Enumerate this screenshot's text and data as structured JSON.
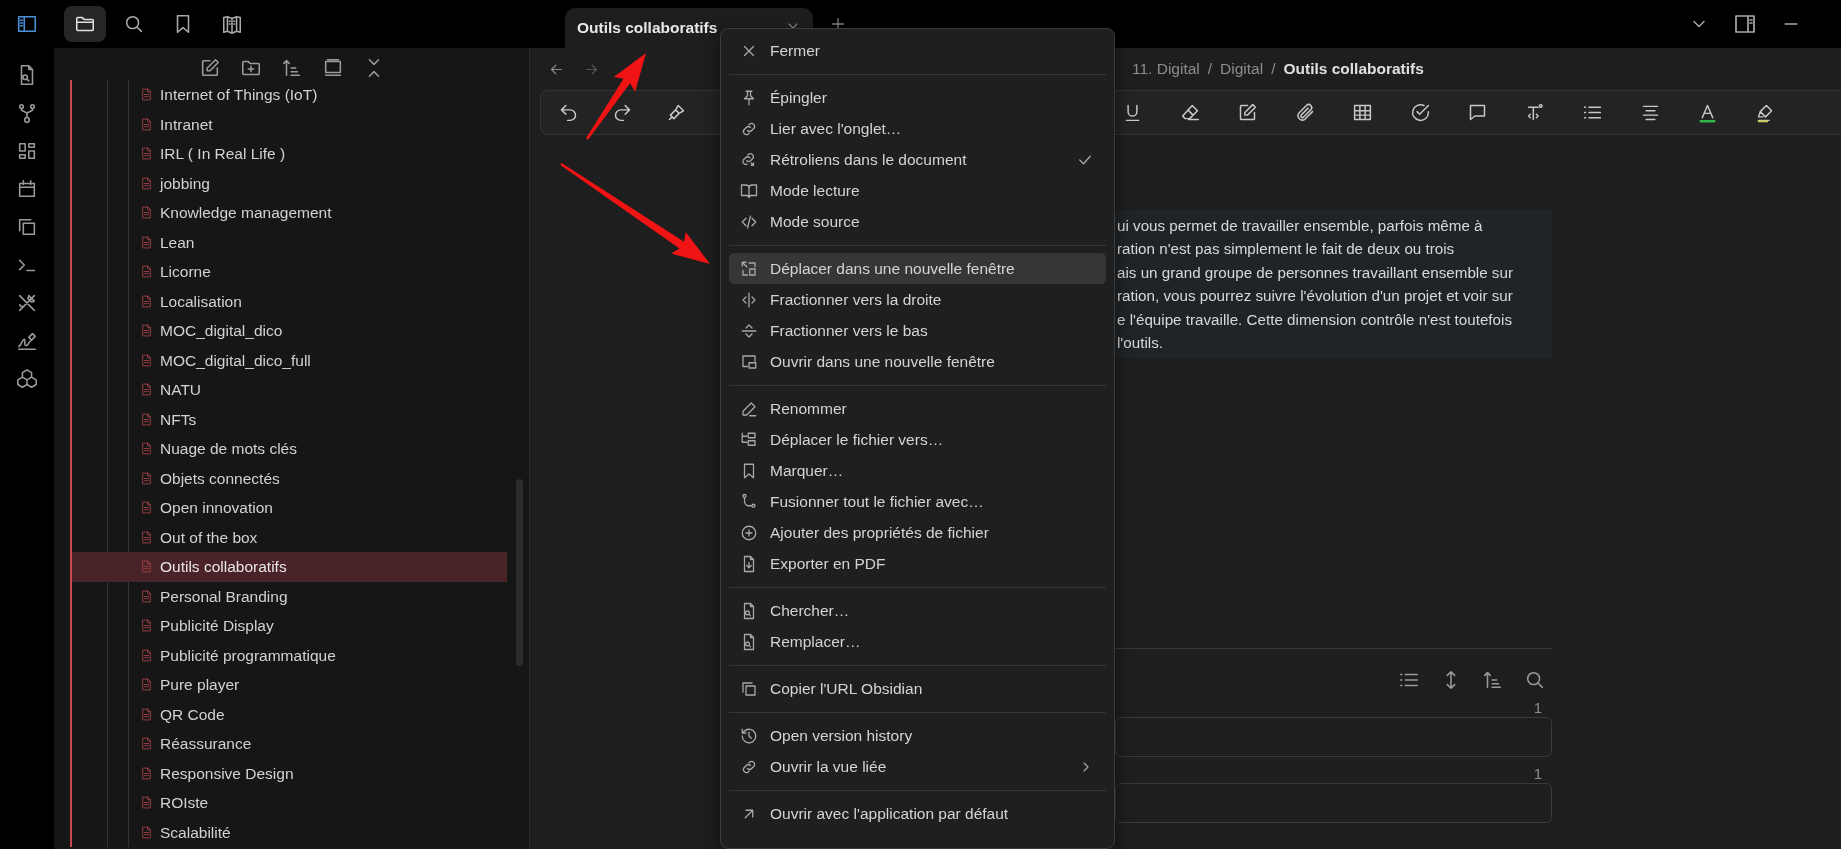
{
  "top_bar": {
    "tab": {
      "title": "Outils collaboratifs",
      "selected": true
    }
  },
  "sidebar": {
    "items": [
      {
        "label": "Internet of Things (IoT)",
        "selected": false
      },
      {
        "label": "Intranet",
        "selected": false
      },
      {
        "label": "IRL ( In Real Life )",
        "selected": false
      },
      {
        "label": "jobbing",
        "selected": false
      },
      {
        "label": "Knowledge management",
        "selected": false
      },
      {
        "label": "Lean",
        "selected": false
      },
      {
        "label": "Licorne",
        "selected": false
      },
      {
        "label": "Localisation",
        "selected": false
      },
      {
        "label": "MOC_digital_dico",
        "selected": false
      },
      {
        "label": "MOC_digital_dico_full",
        "selected": false
      },
      {
        "label": "NATU",
        "selected": false
      },
      {
        "label": "NFTs",
        "selected": false
      },
      {
        "label": "Nuage de mots clés",
        "selected": false
      },
      {
        "label": "Objets connectés",
        "selected": false
      },
      {
        "label": "Open innovation",
        "selected": false
      },
      {
        "label": "Out of the box",
        "selected": false
      },
      {
        "label": "Outils collaboratifs",
        "selected": true
      },
      {
        "label": "Personal Branding",
        "selected": false
      },
      {
        "label": "Publicité Display",
        "selected": false
      },
      {
        "label": "Publicité programmatique",
        "selected": false
      },
      {
        "label": "Pure player",
        "selected": false
      },
      {
        "label": "QR Code",
        "selected": false
      },
      {
        "label": "Réassurance",
        "selected": false
      },
      {
        "label": "Responsive Design",
        "selected": false
      },
      {
        "label": "ROIste",
        "selected": false
      },
      {
        "label": "Scalabilité",
        "selected": false
      }
    ]
  },
  "editor": {
    "breadcrumb": [
      {
        "label": "11. Digital",
        "current": false
      },
      {
        "label": "Digital",
        "current": false
      },
      {
        "label": "Outils collaboratifs",
        "current": true
      }
    ],
    "breadcrumb_separators": [
      "/",
      "/"
    ],
    "paragraph_lines": [
      "ui vous permet de travailler ensemble, parfois même à",
      "ration n'est pas simplement le fait de deux ou trois",
      "ais un grand groupe de personnes travaillant ensemble sur",
      "ration, vous pourrez suivre l'évolution d'un projet et voir sur",
      "e l'équipe travaille. Cette dimension contrôle n'est toutefois",
      "l'outils."
    ],
    "backlinks": {
      "groups": [
        {
          "count": "1"
        },
        {
          "count": "1"
        }
      ]
    }
  },
  "context_menu": {
    "groups": [
      {
        "items": [
          {
            "label": "Fermer",
            "selected": false,
            "checked": false,
            "submenu": false
          }
        ]
      },
      {
        "items": [
          {
            "label": "Épingler",
            "selected": false,
            "checked": false,
            "submenu": false
          },
          {
            "label": "Lier avec l'onglet…",
            "selected": false,
            "checked": false,
            "submenu": false
          },
          {
            "label": "Rétroliens dans le document",
            "selected": false,
            "checked": true,
            "submenu": false
          },
          {
            "label": "Mode lecture",
            "selected": false,
            "checked": false,
            "submenu": false
          },
          {
            "label": "Mode source",
            "selected": false,
            "checked": false,
            "submenu": false
          }
        ]
      },
      {
        "items": [
          {
            "label": "Déplacer dans une nouvelle fenêtre",
            "selected": true,
            "checked": false,
            "submenu": false
          },
          {
            "label": "Fractionner vers la droite",
            "selected": false,
            "checked": false,
            "submenu": false
          },
          {
            "label": "Fractionner vers le bas",
            "selected": false,
            "checked": false,
            "submenu": false
          },
          {
            "label": "Ouvrir dans une nouvelle fenêtre",
            "selected": false,
            "checked": false,
            "submenu": false
          }
        ]
      },
      {
        "items": [
          {
            "label": "Renommer",
            "selected": false,
            "checked": false,
            "submenu": false
          },
          {
            "label": "Déplacer le fichier vers…",
            "selected": false,
            "checked": false,
            "submenu": false
          },
          {
            "label": "Marquer…",
            "selected": false,
            "checked": false,
            "submenu": false
          },
          {
            "label": "Fusionner tout le fichier avec…",
            "selected": false,
            "checked": false,
            "submenu": false
          },
          {
            "label": "Ajouter des propriétés de fichier",
            "selected": false,
            "checked": false,
            "submenu": false
          },
          {
            "label": "Exporter en PDF",
            "selected": false,
            "checked": false,
            "submenu": false
          }
        ]
      },
      {
        "items": [
          {
            "label": "Chercher…",
            "selected": false,
            "checked": false,
            "submenu": false
          },
          {
            "label": "Remplacer…",
            "selected": false,
            "checked": false,
            "submenu": false
          }
        ]
      },
      {
        "items": [
          {
            "label": "Copier l'URL Obsidian",
            "selected": false,
            "checked": false,
            "submenu": false
          }
        ]
      },
      {
        "items": [
          {
            "label": "Open version history",
            "selected": false,
            "checked": false,
            "submenu": false
          },
          {
            "label": "Ouvrir la vue liée",
            "selected": false,
            "checked": false,
            "submenu": true
          }
        ]
      },
      {
        "items": [
          {
            "label": "Ouvrir avec l'application par défaut",
            "selected": false,
            "checked": false,
            "submenu": false
          }
        ]
      }
    ]
  }
}
